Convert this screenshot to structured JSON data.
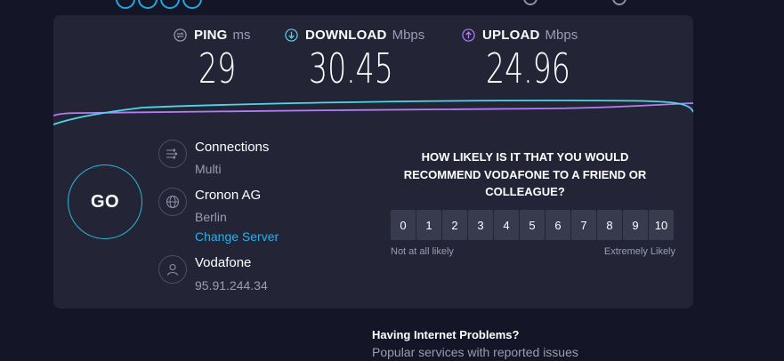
{
  "metrics": {
    "ping": {
      "label": "PING",
      "unit": "ms",
      "value": "29",
      "icon": "ping-icon",
      "color": "#9a9cb0"
    },
    "download": {
      "label": "DOWNLOAD",
      "unit": "Mbps",
      "value": "30.45",
      "icon": "download-arrow-icon",
      "color": "#4fd6e6"
    },
    "upload": {
      "label": "UPLOAD",
      "unit": "Mbps",
      "value": "24.96",
      "icon": "upload-arrow-icon",
      "color": "#b07ff0"
    }
  },
  "go_button": {
    "label": "GO",
    "color": "#29b8d7"
  },
  "connections": {
    "title": "Connections",
    "value": "Multi",
    "icon": "connections-icon"
  },
  "server": {
    "name": "Cronon AG",
    "location": "Berlin",
    "change_label": "Change Server",
    "icon": "globe-icon"
  },
  "provider": {
    "name": "Vodafone",
    "ip": "95.91.244.34",
    "icon": "user-icon"
  },
  "survey": {
    "question": "HOW LIKELY IS IT THAT YOU WOULD RECOMMEND VODAFONE TO A FRIEND OR COLLEAGUE?",
    "scale": [
      "0",
      "1",
      "2",
      "3",
      "4",
      "5",
      "6",
      "7",
      "8",
      "9",
      "10"
    ],
    "low_label": "Not at all likely",
    "high_label": "Extremely Likely"
  },
  "problems": {
    "title": "Having Internet Problems?",
    "subtitle": "Popular services with reported issues"
  },
  "colors": {
    "accent": "#2bb0e8",
    "panel": "#232537",
    "background": "#141526"
  }
}
